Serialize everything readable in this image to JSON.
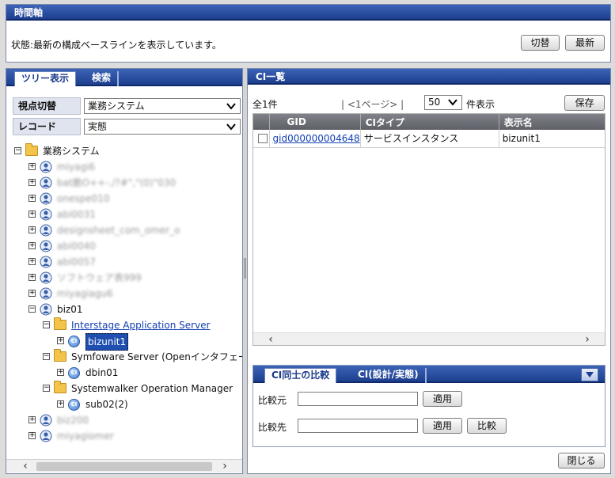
{
  "timeline": {
    "title": "時間軸",
    "status_text": "状態:最新の構成ベースラインを表示しています。",
    "switch_btn": "切替",
    "latest_btn": "最新"
  },
  "left": {
    "tabs": [
      "ツリー表示",
      "検索"
    ],
    "viewpoint_label": "視点切替",
    "viewpoint_value": "業務システム",
    "record_label": "レコード",
    "record_value": "実態",
    "tree": [
      {
        "label": "業務システム",
        "depth": 0,
        "pm": "−",
        "icon": "folder",
        "style": ""
      },
      {
        "label": "miyagi6",
        "depth": 1,
        "pm": "+",
        "icon": "person",
        "style": "blur"
      },
      {
        "label": "bat脆O++-./?#\",\"(0)\"030",
        "depth": 1,
        "pm": "+",
        "icon": "person",
        "style": "blur"
      },
      {
        "label": "onespe010",
        "depth": 1,
        "pm": "+",
        "icon": "person",
        "style": "blur"
      },
      {
        "label": "abi0031",
        "depth": 1,
        "pm": "+",
        "icon": "person",
        "style": "blur"
      },
      {
        "label": "designsheet_com_omer_o",
        "depth": 1,
        "pm": "+",
        "icon": "person",
        "style": "blur"
      },
      {
        "label": "abi0040",
        "depth": 1,
        "pm": "+",
        "icon": "person",
        "style": "blur"
      },
      {
        "label": "abi0057",
        "depth": 1,
        "pm": "+",
        "icon": "person",
        "style": "blur"
      },
      {
        "label": "ソフトウェア表999",
        "depth": 1,
        "pm": "+",
        "icon": "person",
        "style": "blur"
      },
      {
        "label": "miyagiagu6",
        "depth": 1,
        "pm": "+",
        "icon": "person",
        "style": "blur"
      },
      {
        "label": "biz01",
        "depth": 1,
        "pm": "−",
        "icon": "person",
        "style": ""
      },
      {
        "label": "Interstage Application Server",
        "depth": 2,
        "pm": "−",
        "icon": "folder",
        "style": "link"
      },
      {
        "label": "bizunit1",
        "depth": 3,
        "pm": "+",
        "icon": "ci",
        "style": "sel"
      },
      {
        "label": "Symfoware Server (Openインタフェース",
        "depth": 2,
        "pm": "−",
        "icon": "folder",
        "style": ""
      },
      {
        "label": "dbin01",
        "depth": 3,
        "pm": "+",
        "icon": "ci",
        "style": ""
      },
      {
        "label": "Systemwalker Operation Manager",
        "depth": 2,
        "pm": "−",
        "icon": "folder",
        "style": ""
      },
      {
        "label": "sub02(2)",
        "depth": 3,
        "pm": "+",
        "icon": "ci",
        "style": ""
      },
      {
        "label": "biz200",
        "depth": 1,
        "pm": "+",
        "icon": "person",
        "style": "blur"
      },
      {
        "label": "miyagiomer",
        "depth": 1,
        "pm": "+",
        "icon": "person",
        "style": "blur"
      }
    ]
  },
  "ci_list": {
    "title": "CI一覧",
    "count": "全1件",
    "pager": "| <1ページ> |",
    "per_page": "50",
    "per_page_suffix": "件表示",
    "save_btn": "保存",
    "columns": [
      "GID",
      "CIタイプ",
      "表示名"
    ],
    "rows": [
      {
        "gid": "gid000000004648",
        "type": "サービスインスタンス",
        "name": "bizunit1"
      }
    ]
  },
  "compare": {
    "tabs": [
      "CI同士の比較",
      "CI(設計/実態)"
    ],
    "source_label": "比較元",
    "target_label": "比較先",
    "apply_btn": "適用",
    "compare_btn": "比較"
  },
  "close_btn": "閉じる",
  "colors": {
    "header": "#1d3f8e",
    "grid_header": "#5d6066",
    "link": "#1440b3"
  }
}
